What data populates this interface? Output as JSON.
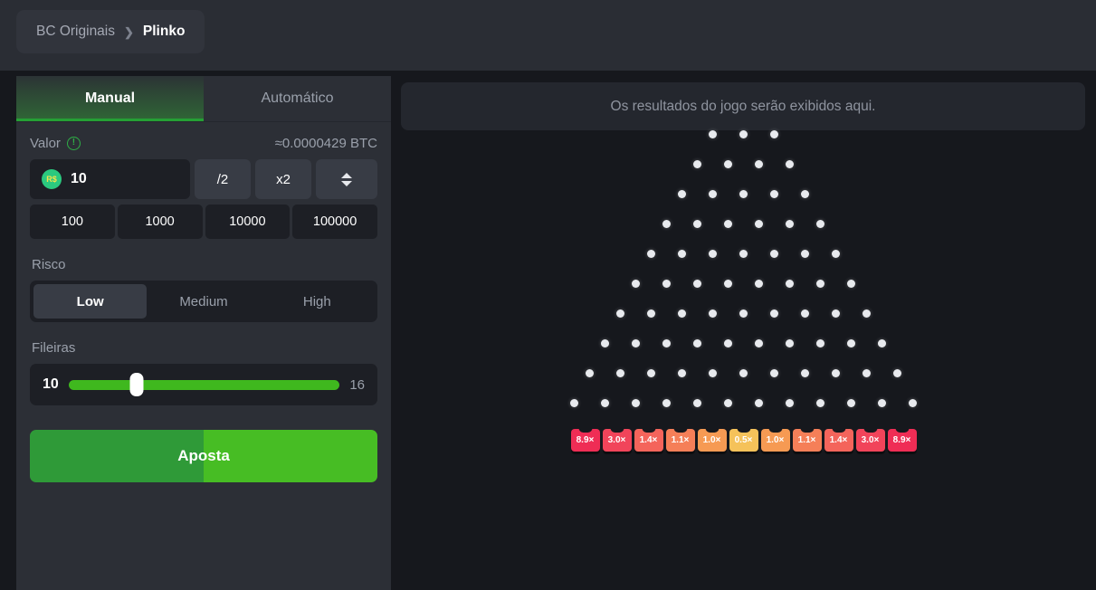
{
  "header": {
    "breadcrumb": {
      "parent": "BC Originais",
      "separator": "❯",
      "current": "Plinko"
    }
  },
  "panel": {
    "tabs": [
      {
        "label": "Manual",
        "active": true
      },
      {
        "label": "Automático",
        "active": false
      }
    ],
    "amount": {
      "label": "Valor",
      "info_icon": "info-exclamation-icon",
      "btc_equivalent": "≈0.0000429 BTC",
      "currency_symbol": "R$",
      "value": "10",
      "half_label": "/2",
      "double_label": "x2",
      "stepper_icon": "up-down-chevron-icon",
      "quick_amounts": [
        "100",
        "1000",
        "10000",
        "100000"
      ]
    },
    "risk": {
      "label": "Risco",
      "options": [
        "Low",
        "Medium",
        "High"
      ],
      "selected": "Low"
    },
    "rows": {
      "label": "Fileiras",
      "min": "10",
      "max": "16",
      "value": 10,
      "thumb_percent": 25
    },
    "bet_button": {
      "label": "Aposta"
    }
  },
  "game": {
    "results_placeholder": "Os resultados do jogo serão exibidos aqui.",
    "board": {
      "peg_rows": [
        3,
        4,
        5,
        6,
        7,
        8,
        9,
        10,
        11,
        12
      ]
    },
    "multipliers": [
      {
        "label": "8.9×",
        "color": "#ef2d55"
      },
      {
        "label": "3.0×",
        "color": "#f1445a"
      },
      {
        "label": "1.4×",
        "color": "#f4645b"
      },
      {
        "label": "1.1×",
        "color": "#f57f58"
      },
      {
        "label": "1.0×",
        "color": "#f69a53"
      },
      {
        "label": "0.5×",
        "color": "#f5c25a"
      },
      {
        "label": "1.0×",
        "color": "#f69a53"
      },
      {
        "label": "1.1×",
        "color": "#f57f58"
      },
      {
        "label": "1.4×",
        "color": "#f4645b"
      },
      {
        "label": "3.0×",
        "color": "#f1445a"
      },
      {
        "label": "8.9×",
        "color": "#ef2d55"
      }
    ]
  },
  "colors": {
    "accent_green": "#3fb81e",
    "panel_bg": "#2c2f36",
    "game_bg": "#16181d",
    "field_bg": "#1d1f25"
  }
}
